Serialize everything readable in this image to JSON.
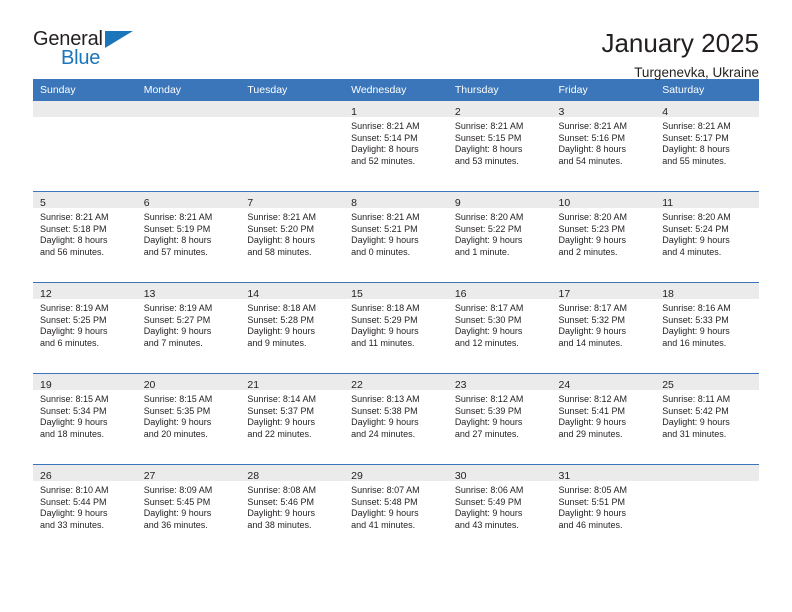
{
  "brand": {
    "name_part1": "General",
    "name_part2": "Blue",
    "accent_color": "#1b75bb",
    "flag_icon": "triangle-flag-icon"
  },
  "header": {
    "title": "January 2025",
    "subtitle": "Turgenevka, Ukraine"
  },
  "calendar": {
    "header_color": "#3b76ba",
    "daynum_band_color": "#ebebeb",
    "weekdays": [
      "Sunday",
      "Monday",
      "Tuesday",
      "Wednesday",
      "Thursday",
      "Friday",
      "Saturday"
    ],
    "weeks": [
      [
        {
          "day": "",
          "empty": true
        },
        {
          "day": "",
          "empty": true
        },
        {
          "day": "",
          "empty": true
        },
        {
          "day": "1",
          "sunrise": "Sunrise: 8:21 AM",
          "sunset": "Sunset: 5:14 PM",
          "daylight_line1": "Daylight: 8 hours",
          "daylight_line2": "and 52 minutes."
        },
        {
          "day": "2",
          "sunrise": "Sunrise: 8:21 AM",
          "sunset": "Sunset: 5:15 PM",
          "daylight_line1": "Daylight: 8 hours",
          "daylight_line2": "and 53 minutes."
        },
        {
          "day": "3",
          "sunrise": "Sunrise: 8:21 AM",
          "sunset": "Sunset: 5:16 PM",
          "daylight_line1": "Daylight: 8 hours",
          "daylight_line2": "and 54 minutes."
        },
        {
          "day": "4",
          "sunrise": "Sunrise: 8:21 AM",
          "sunset": "Sunset: 5:17 PM",
          "daylight_line1": "Daylight: 8 hours",
          "daylight_line2": "and 55 minutes."
        }
      ],
      [
        {
          "day": "5",
          "sunrise": "Sunrise: 8:21 AM",
          "sunset": "Sunset: 5:18 PM",
          "daylight_line1": "Daylight: 8 hours",
          "daylight_line2": "and 56 minutes."
        },
        {
          "day": "6",
          "sunrise": "Sunrise: 8:21 AM",
          "sunset": "Sunset: 5:19 PM",
          "daylight_line1": "Daylight: 8 hours",
          "daylight_line2": "and 57 minutes."
        },
        {
          "day": "7",
          "sunrise": "Sunrise: 8:21 AM",
          "sunset": "Sunset: 5:20 PM",
          "daylight_line1": "Daylight: 8 hours",
          "daylight_line2": "and 58 minutes."
        },
        {
          "day": "8",
          "sunrise": "Sunrise: 8:21 AM",
          "sunset": "Sunset: 5:21 PM",
          "daylight_line1": "Daylight: 9 hours",
          "daylight_line2": "and 0 minutes."
        },
        {
          "day": "9",
          "sunrise": "Sunrise: 8:20 AM",
          "sunset": "Sunset: 5:22 PM",
          "daylight_line1": "Daylight: 9 hours",
          "daylight_line2": "and 1 minute."
        },
        {
          "day": "10",
          "sunrise": "Sunrise: 8:20 AM",
          "sunset": "Sunset: 5:23 PM",
          "daylight_line1": "Daylight: 9 hours",
          "daylight_line2": "and 2 minutes."
        },
        {
          "day": "11",
          "sunrise": "Sunrise: 8:20 AM",
          "sunset": "Sunset: 5:24 PM",
          "daylight_line1": "Daylight: 9 hours",
          "daylight_line2": "and 4 minutes."
        }
      ],
      [
        {
          "day": "12",
          "sunrise": "Sunrise: 8:19 AM",
          "sunset": "Sunset: 5:25 PM",
          "daylight_line1": "Daylight: 9 hours",
          "daylight_line2": "and 6 minutes."
        },
        {
          "day": "13",
          "sunrise": "Sunrise: 8:19 AM",
          "sunset": "Sunset: 5:27 PM",
          "daylight_line1": "Daylight: 9 hours",
          "daylight_line2": "and 7 minutes."
        },
        {
          "day": "14",
          "sunrise": "Sunrise: 8:18 AM",
          "sunset": "Sunset: 5:28 PM",
          "daylight_line1": "Daylight: 9 hours",
          "daylight_line2": "and 9 minutes."
        },
        {
          "day": "15",
          "sunrise": "Sunrise: 8:18 AM",
          "sunset": "Sunset: 5:29 PM",
          "daylight_line1": "Daylight: 9 hours",
          "daylight_line2": "and 11 minutes."
        },
        {
          "day": "16",
          "sunrise": "Sunrise: 8:17 AM",
          "sunset": "Sunset: 5:30 PM",
          "daylight_line1": "Daylight: 9 hours",
          "daylight_line2": "and 12 minutes."
        },
        {
          "day": "17",
          "sunrise": "Sunrise: 8:17 AM",
          "sunset": "Sunset: 5:32 PM",
          "daylight_line1": "Daylight: 9 hours",
          "daylight_line2": "and 14 minutes."
        },
        {
          "day": "18",
          "sunrise": "Sunrise: 8:16 AM",
          "sunset": "Sunset: 5:33 PM",
          "daylight_line1": "Daylight: 9 hours",
          "daylight_line2": "and 16 minutes."
        }
      ],
      [
        {
          "day": "19",
          "sunrise": "Sunrise: 8:15 AM",
          "sunset": "Sunset: 5:34 PM",
          "daylight_line1": "Daylight: 9 hours",
          "daylight_line2": "and 18 minutes."
        },
        {
          "day": "20",
          "sunrise": "Sunrise: 8:15 AM",
          "sunset": "Sunset: 5:35 PM",
          "daylight_line1": "Daylight: 9 hours",
          "daylight_line2": "and 20 minutes."
        },
        {
          "day": "21",
          "sunrise": "Sunrise: 8:14 AM",
          "sunset": "Sunset: 5:37 PM",
          "daylight_line1": "Daylight: 9 hours",
          "daylight_line2": "and 22 minutes."
        },
        {
          "day": "22",
          "sunrise": "Sunrise: 8:13 AM",
          "sunset": "Sunset: 5:38 PM",
          "daylight_line1": "Daylight: 9 hours",
          "daylight_line2": "and 24 minutes."
        },
        {
          "day": "23",
          "sunrise": "Sunrise: 8:12 AM",
          "sunset": "Sunset: 5:39 PM",
          "daylight_line1": "Daylight: 9 hours",
          "daylight_line2": "and 27 minutes."
        },
        {
          "day": "24",
          "sunrise": "Sunrise: 8:12 AM",
          "sunset": "Sunset: 5:41 PM",
          "daylight_line1": "Daylight: 9 hours",
          "daylight_line2": "and 29 minutes."
        },
        {
          "day": "25",
          "sunrise": "Sunrise: 8:11 AM",
          "sunset": "Sunset: 5:42 PM",
          "daylight_line1": "Daylight: 9 hours",
          "daylight_line2": "and 31 minutes."
        }
      ],
      [
        {
          "day": "26",
          "sunrise": "Sunrise: 8:10 AM",
          "sunset": "Sunset: 5:44 PM",
          "daylight_line1": "Daylight: 9 hours",
          "daylight_line2": "and 33 minutes."
        },
        {
          "day": "27",
          "sunrise": "Sunrise: 8:09 AM",
          "sunset": "Sunset: 5:45 PM",
          "daylight_line1": "Daylight: 9 hours",
          "daylight_line2": "and 36 minutes."
        },
        {
          "day": "28",
          "sunrise": "Sunrise: 8:08 AM",
          "sunset": "Sunset: 5:46 PM",
          "daylight_line1": "Daylight: 9 hours",
          "daylight_line2": "and 38 minutes."
        },
        {
          "day": "29",
          "sunrise": "Sunrise: 8:07 AM",
          "sunset": "Sunset: 5:48 PM",
          "daylight_line1": "Daylight: 9 hours",
          "daylight_line2": "and 41 minutes."
        },
        {
          "day": "30",
          "sunrise": "Sunrise: 8:06 AM",
          "sunset": "Sunset: 5:49 PM",
          "daylight_line1": "Daylight: 9 hours",
          "daylight_line2": "and 43 minutes."
        },
        {
          "day": "31",
          "sunrise": "Sunrise: 8:05 AM",
          "sunset": "Sunset: 5:51 PM",
          "daylight_line1": "Daylight: 9 hours",
          "daylight_line2": "and 46 minutes."
        },
        {
          "day": "",
          "empty": true
        }
      ]
    ]
  }
}
